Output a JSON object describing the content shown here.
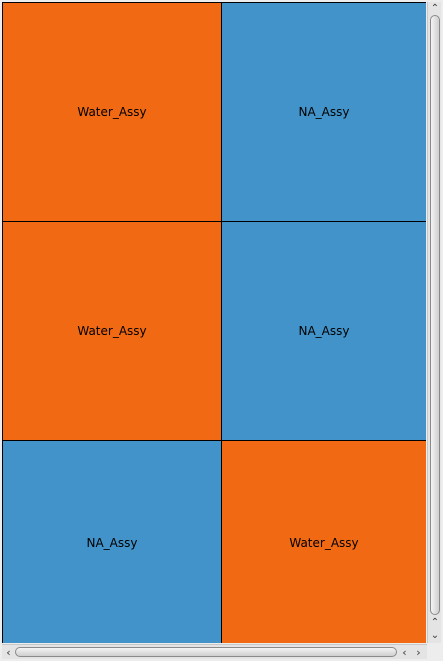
{
  "grid": {
    "cells": [
      {
        "label": "Water_Assy",
        "color": "#f26913"
      },
      {
        "label": "NA_Assy",
        "color": "#4193c9"
      },
      {
        "label": "Water_Assy",
        "color": "#f26913"
      },
      {
        "label": "NA_Assy",
        "color": "#4193c9"
      },
      {
        "label": "NA_Assy",
        "color": "#4193c9"
      },
      {
        "label": "Water_Assy",
        "color": "#f26913"
      }
    ]
  },
  "scrollbars": {
    "vertical_icons": [
      "chevron-up-icon",
      "chevron-down-icon",
      "chevron-up-icon",
      "chevron-down-icon"
    ],
    "horizontal_icons": [
      "chevron-left-icon",
      "chevron-left-icon",
      "chevron-right-icon"
    ]
  }
}
